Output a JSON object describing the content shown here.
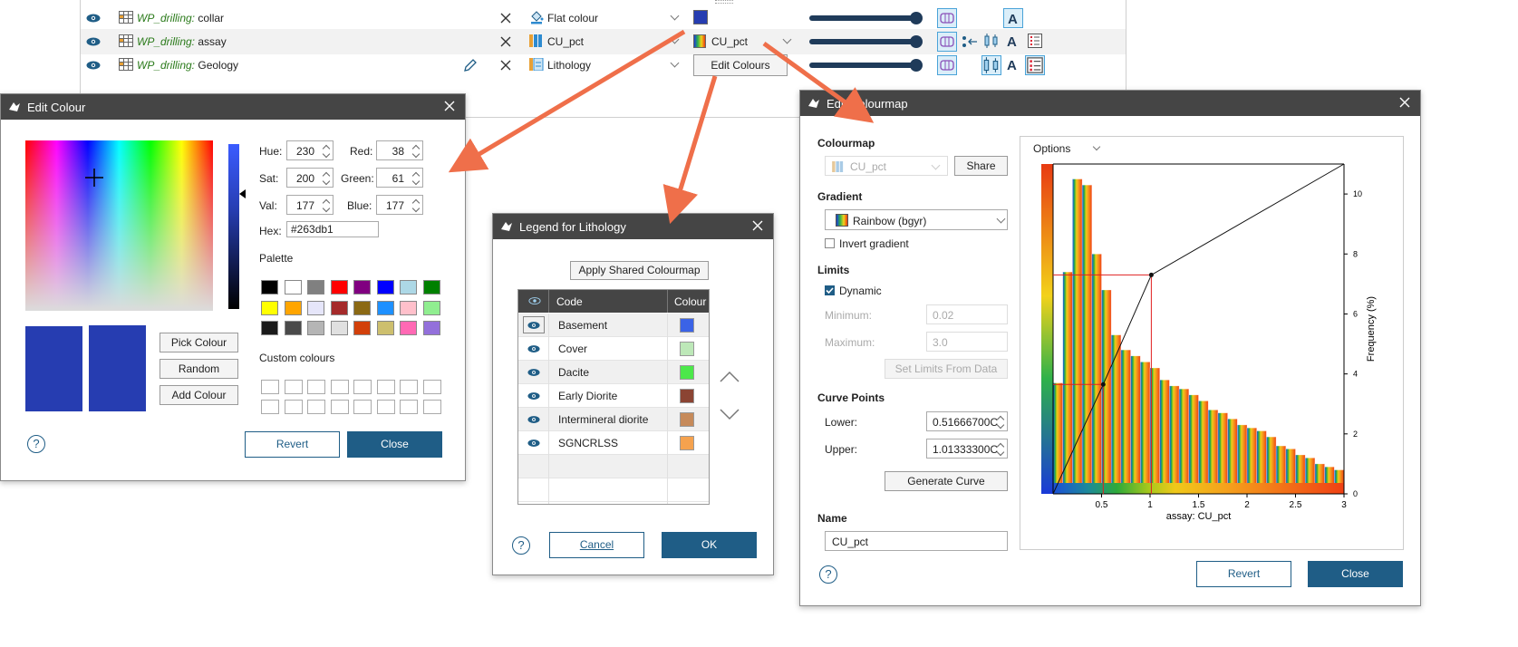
{
  "layers": {
    "rows": [
      {
        "name_italic": "WP_drilling:",
        "name_rest": " collar",
        "mode": "Flat colour",
        "swatch": "#263db1"
      },
      {
        "name_italic": "WP_drilling:",
        "name_rest": " assay",
        "mode": "CU_pct",
        "colourmap": "CU_pct"
      },
      {
        "name_italic": "WP_drilling:",
        "name_rest": " Geology",
        "mode": "Lithology",
        "edit_button": "Edit Colours"
      }
    ]
  },
  "edit_colour": {
    "title": "Edit Colour",
    "fields": [
      {
        "label": "Hue:",
        "value": "230"
      },
      {
        "label": "Sat:",
        "value": "200"
      },
      {
        "label": "Val:",
        "value": "177"
      },
      {
        "label": "Red:",
        "value": "38"
      },
      {
        "label": "Green:",
        "value": "61"
      },
      {
        "label": "Blue:",
        "value": "177"
      }
    ],
    "hex_label": "Hex:",
    "hex_value": "#263db1",
    "palette_label": "Palette",
    "palette": [
      "#000000",
      "#ffffff",
      "#808080",
      "#ff0000",
      "#800080",
      "#0000ff",
      "#add8e6",
      "#008000",
      "#ffff00",
      "#ffa500",
      "#e6e6fa",
      "#a52a2a",
      "#8b6914",
      "#1e90ff",
      "#ffc0cb",
      "#90ee90",
      "#1a1a1a",
      "#4a4a4a",
      "#b5b5b5",
      "#e0e0e0",
      "#d2400a",
      "#cdbf6e",
      "#ff69b4",
      "#9370db"
    ],
    "custom_label": "Custom colours",
    "pick_button": "Pick Colour",
    "random_button": "Random",
    "add_button": "Add Colour",
    "revert_button": "Revert",
    "close_button": "Close",
    "current_colour": "#263db1",
    "help": "?"
  },
  "legend": {
    "title": "Legend for Lithology",
    "apply_button": "Apply Shared Colourmap",
    "col_code": "Code",
    "col_colour": "Colour",
    "rows": [
      {
        "code": "Basement",
        "colour": "#3b63e6"
      },
      {
        "code": "Cover",
        "colour": "#bde8b8"
      },
      {
        "code": "Dacite",
        "colour": "#4ce84a"
      },
      {
        "code": "Early Diorite",
        "colour": "#8b4433"
      },
      {
        "code": "Intermineral diorite",
        "colour": "#c68a5a"
      },
      {
        "code": "SGNCRLSS",
        "colour": "#f5a24e"
      }
    ],
    "cancel_button": "Cancel",
    "ok_button": "OK",
    "help": "?"
  },
  "edit_colourmap": {
    "title": "Edit Colourmap",
    "colourmap_label": "Colourmap",
    "colourmap_value": "CU_pct",
    "share_button": "Share",
    "gradient_label": "Gradient",
    "gradient_value": "Rainbow (bgyr)",
    "invert_label": "Invert gradient",
    "limits_label": "Limits",
    "dynamic_label": "Dynamic",
    "minimum_label": "Minimum:",
    "minimum_value": "0.02",
    "maximum_label": "Maximum:",
    "maximum_value": "3.0",
    "set_limits_button": "Set Limits From Data",
    "curve_label": "Curve Points",
    "lower_label": "Lower:",
    "lower_value": "0.51666700C",
    "upper_label": "Upper:",
    "upper_value": "1.01333300C",
    "generate_button": "Generate Curve",
    "name_label": "Name",
    "name_value": "CU_pct",
    "options_label": "Options",
    "revert_button": "Revert",
    "close_button": "Close",
    "help": "?"
  },
  "chart_data": {
    "type": "bar",
    "xlabel": "assay: CU_pct",
    "ylabel": "Frequency (%)",
    "xlim": [
      0,
      3
    ],
    "ylim": [
      0,
      11
    ],
    "x_ticks": [
      0.5,
      1,
      1.5,
      2,
      2.5,
      3
    ],
    "y_ticks": [
      0,
      2,
      4,
      6,
      8,
      10
    ],
    "bin_width": 0.1,
    "bins_start": [
      0.0,
      0.1,
      0.2,
      0.3,
      0.4,
      0.5,
      0.6,
      0.7,
      0.8,
      0.9,
      1.0,
      1.1,
      1.2,
      1.3,
      1.4,
      1.5,
      1.6,
      1.7,
      1.8,
      1.9,
      2.0,
      2.1,
      2.2,
      2.3,
      2.4,
      2.5,
      2.6,
      2.7,
      2.8,
      2.9
    ],
    "values": [
      3.7,
      7.4,
      10.5,
      10.3,
      8.0,
      6.8,
      5.3,
      4.8,
      4.6,
      4.4,
      4.2,
      3.8,
      3.6,
      3.5,
      3.3,
      3.1,
      2.8,
      2.7,
      2.5,
      2.3,
      2.2,
      2.1,
      1.9,
      1.6,
      1.5,
      1.3,
      1.2,
      1.0,
      0.9,
      0.8
    ],
    "curve_points": [
      [
        0,
        0
      ],
      [
        0.517,
        3.65
      ],
      [
        1.013,
        7.3
      ],
      [
        3,
        11
      ]
    ],
    "grid": false,
    "legend": "none"
  }
}
